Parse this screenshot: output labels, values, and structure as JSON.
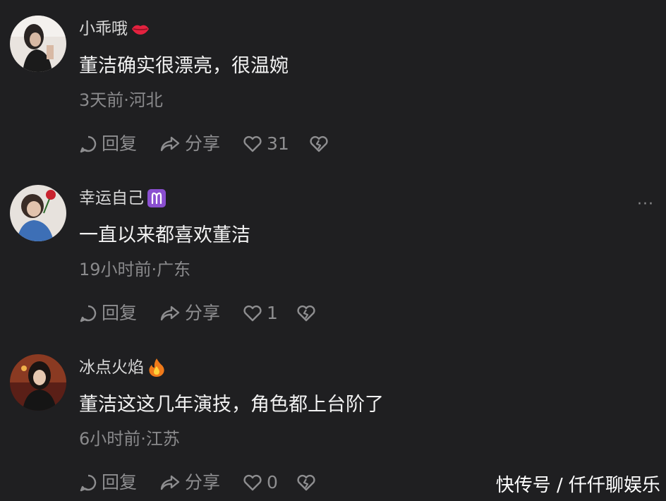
{
  "comments": [
    {
      "username": "小乖哦",
      "badge_icon": "lips-icon",
      "text": "董洁确实很漂亮，很温婉",
      "meta": "3天前·河北",
      "reply_label": "回复",
      "share_label": "分享",
      "like_count": "31"
    },
    {
      "username": "幸运自己",
      "badge_icon": "aries-icon",
      "text": "一直以来都喜欢董洁",
      "meta": "19小时前·广东",
      "reply_label": "回复",
      "share_label": "分享",
      "like_count": "1"
    },
    {
      "username": "冰点火焰",
      "badge_icon": "fire-icon",
      "text": "董洁这这几年演技，角色都上台阶了",
      "meta": "6小时前·江苏",
      "reply_label": "回复",
      "share_label": "分享",
      "like_count": "0"
    }
  ],
  "more_label": "···",
  "watermark": "快传号 / 仟仟聊娱乐",
  "colors": {
    "background": "#1f1f21",
    "username": "#d8d8d8",
    "text": "#f2f2f2",
    "meta": "#8a8a8c",
    "action": "#8e8e90"
  }
}
